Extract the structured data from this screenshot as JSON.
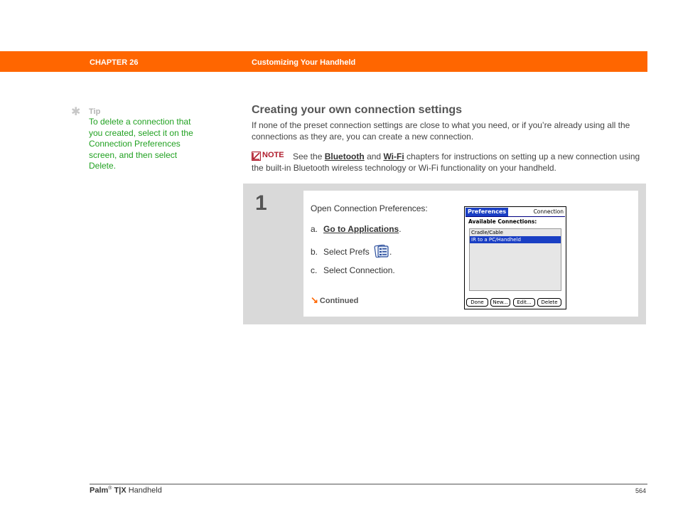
{
  "header": {
    "chapter": "CHAPTER 26",
    "title": "Customizing Your Handheld",
    "bar_color": "#ff6600"
  },
  "tip": {
    "icon": "asterisk-icon",
    "label": "Tip",
    "text": "To delete a connection that you created, select it on the Connection Preferences screen, and then select Delete.",
    "color": "#21a121"
  },
  "section": {
    "heading": "Creating your own connection settings",
    "intro": "If none of the preset connection settings are close to what you need, or if you’re already using all the connections as they are, you can create a new connection."
  },
  "note": {
    "icon": "note-icon",
    "label": "NOTE",
    "text_before": "See the",
    "link1": "Bluetooth",
    "text_mid": "and",
    "link2": "Wi-Fi",
    "text_after": "chapters for instructions on setting up a new connection using the built-in Bluetooth wireless technology or Wi-Fi functionality on your handheld."
  },
  "step": {
    "number": "1",
    "intro": "Open Connection Preferences:",
    "items": [
      {
        "prefix": "a.",
        "link": "Go to Applications",
        "suffix": "."
      },
      {
        "prefix": "b.",
        "text": "Select Prefs",
        "icon": "prefs-icon",
        "suffix": "."
      },
      {
        "prefix": "c.",
        "text": "Select Connection."
      }
    ],
    "continued": "Continued"
  },
  "palm_screen": {
    "title": "Preferences",
    "panel": "Connection",
    "list_label": "Available Connections:",
    "connections": [
      {
        "label": "Cradle/Cable",
        "selected": false
      },
      {
        "label": "IR to a PC/Handheld",
        "selected": true
      }
    ],
    "buttons": [
      "Done",
      "New...",
      "Edit...",
      "Delete"
    ],
    "highlight_color": "#1a3fc4"
  },
  "footer": {
    "brand": "Palm",
    "registered": "®",
    "model": "T|X",
    "product_suffix": "Handheld",
    "page_number": "564"
  }
}
